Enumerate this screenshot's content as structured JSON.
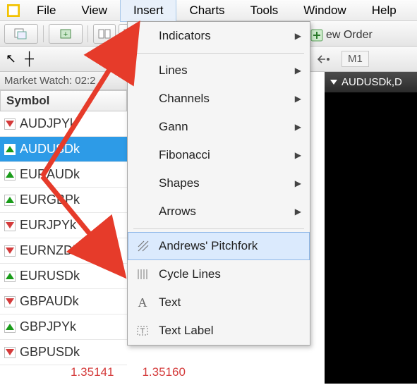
{
  "menu": {
    "items": [
      "File",
      "View",
      "Insert",
      "Charts",
      "Tools",
      "Window",
      "Help"
    ],
    "active_index": 2
  },
  "toolbar": {
    "new_order_label": "ew Order"
  },
  "market_watch": {
    "title": "Market Watch: 02:2",
    "header": "Symbol",
    "symbols": [
      {
        "name": "AUDJPYk",
        "dir": "dn"
      },
      {
        "name": "AUDUSDk",
        "dir": "up",
        "selected": true
      },
      {
        "name": "EURAUDk",
        "dir": "up"
      },
      {
        "name": "EURGBPk",
        "dir": "up"
      },
      {
        "name": "EURJPYk",
        "dir": "dn"
      },
      {
        "name": "EURNZDk",
        "dir": "dn"
      },
      {
        "name": "EURUSDk",
        "dir": "up"
      },
      {
        "name": "GBPAUDk",
        "dir": "dn"
      },
      {
        "name": "GBPJPYk",
        "dir": "up"
      },
      {
        "name": "GBPUSDk",
        "dir": "dn"
      }
    ],
    "prices": [
      "1.35141",
      "1.35160"
    ]
  },
  "right": {
    "timeframe": "M1",
    "chart_title": "AUDUSDk,D"
  },
  "insert_menu": {
    "groups1": [
      "Indicators"
    ],
    "groups2": [
      "Lines",
      "Channels",
      "Gann",
      "Fibonacci",
      "Shapes",
      "Arrows"
    ],
    "items": [
      {
        "icon": "pitchfork",
        "label": "Andrews' Pitchfork",
        "hover": true
      },
      {
        "icon": "cycle",
        "label": "Cycle Lines"
      },
      {
        "icon": "text",
        "label": "Text"
      },
      {
        "icon": "textlabel",
        "label": "Text Label"
      }
    ]
  }
}
